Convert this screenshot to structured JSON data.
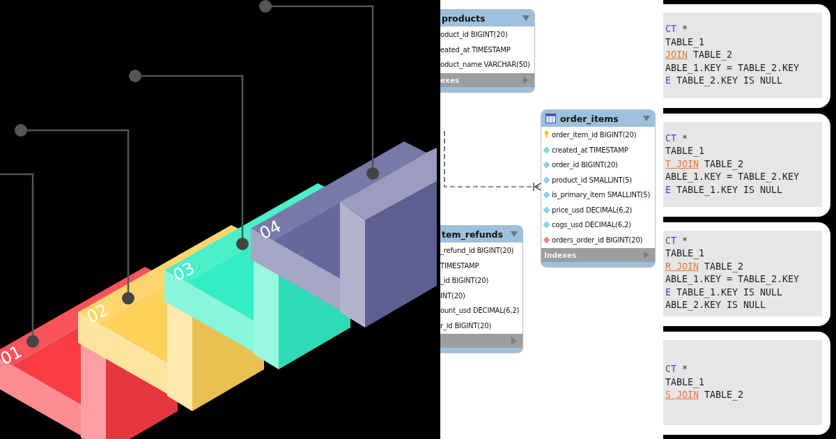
{
  "illustration": {
    "steps": [
      {
        "label": "01",
        "color": "#fa3c45"
      },
      {
        "label": "02",
        "color": "#fdd25a"
      },
      {
        "label": "03",
        "color": "#33eec4"
      },
      {
        "label": "04",
        "color": "#67679e"
      }
    ]
  },
  "diagram": {
    "tables": [
      {
        "name": "products",
        "kind": "clipped",
        "columns": [
          {
            "text": "oduct_id BIGINT(20)"
          },
          {
            "text": "eated_at TIMESTAMP"
          },
          {
            "text": "oduct_name VARCHAR(50)"
          }
        ],
        "indexes_label": "exes"
      },
      {
        "name": "order_items",
        "kind": "full",
        "columns": [
          {
            "text": "order_item_id BIGINT(20)",
            "kind": "primary_key"
          },
          {
            "text": "created_at TIMESTAMP",
            "kind": "column"
          },
          {
            "text": "order_id BIGINT(20)",
            "kind": "column"
          },
          {
            "text": "product_id SMALLINT(5)",
            "kind": "column"
          },
          {
            "text": "is_primary_item SMALLINT(5)",
            "kind": "column"
          },
          {
            "text": "price_usd DECIMAL(6,2)",
            "kind": "column"
          },
          {
            "text": "cogs_usd DECIMAL(6,2)",
            "kind": "column"
          },
          {
            "text": "orders_order_id BIGINT(20)",
            "kind": "foreign_key"
          }
        ],
        "indexes_label": "Indexes"
      },
      {
        "name": "tem_refunds",
        "kind": "clipped",
        "columns": [
          {
            "text": "_refund_id BIGINT(20)"
          },
          {
            "text": "TIMESTAMP"
          },
          {
            "text": "_id BIGINT(20)"
          },
          {
            "text": "INT(20)"
          },
          {
            "text": "ount_usd DECIMAL(6,2)"
          },
          {
            "text": "r_id BIGINT(20)"
          }
        ]
      }
    ]
  },
  "code_cards": [
    {
      "lines": [
        [
          {
            "text": "CT",
            "kind": "keyword"
          },
          {
            "text": " *",
            "kind": "plain"
          }
        ],
        [
          {
            "text": "TABLE_1",
            "kind": "plain"
          }
        ],
        [
          {
            "text": "JOIN",
            "kind": "join"
          },
          {
            "text": " TABLE_2",
            "kind": "plain"
          }
        ],
        [
          {
            "text": "ABLE_1.KEY = TABLE_2.KEY",
            "kind": "plain"
          }
        ],
        [
          {
            "text": "E",
            "kind": "keyword"
          },
          {
            "text": " TABLE_2.KEY IS NULL",
            "kind": "plain"
          }
        ]
      ]
    },
    {
      "lines": [
        [
          {
            "text": "CT",
            "kind": "keyword"
          },
          {
            "text": " *",
            "kind": "plain"
          }
        ],
        [
          {
            "text": "TABLE_1",
            "kind": "plain"
          }
        ],
        [
          {
            "text": "T JOIN",
            "kind": "join"
          },
          {
            "text": " TABLE_2",
            "kind": "plain"
          }
        ],
        [
          {
            "text": "ABLE_1.KEY = TABLE_2.KEY",
            "kind": "plain"
          }
        ],
        [
          {
            "text": "E",
            "kind": "keyword"
          },
          {
            "text": " TABLE_1.KEY IS NULL",
            "kind": "plain"
          }
        ]
      ]
    },
    {
      "lines": [
        [
          {
            "text": "CT",
            "kind": "keyword"
          },
          {
            "text": " *",
            "kind": "plain"
          }
        ],
        [
          {
            "text": "TABLE_1",
            "kind": "plain"
          }
        ],
        [
          {
            "text": "R JOIN",
            "kind": "join"
          },
          {
            "text": " TABLE_2",
            "kind": "plain"
          }
        ],
        [
          {
            "text": "ABLE_1.KEY = TABLE_2.KEY",
            "kind": "plain"
          }
        ],
        [
          {
            "text": "E",
            "kind": "keyword"
          },
          {
            "text": " TABLE_1.KEY IS NULL",
            "kind": "plain"
          }
        ],
        [
          {
            "text": "ABLE_2.KEY IS NULL",
            "kind": "plain"
          }
        ]
      ]
    },
    {
      "lines": [
        [
          {
            "text": "CT",
            "kind": "keyword"
          },
          {
            "text": " *",
            "kind": "plain"
          }
        ],
        [
          {
            "text": "TABLE_1",
            "kind": "plain"
          }
        ],
        [
          {
            "text": "S JOIN",
            "kind": "join"
          },
          {
            "text": " TABLE_2",
            "kind": "plain"
          }
        ]
      ]
    }
  ]
}
